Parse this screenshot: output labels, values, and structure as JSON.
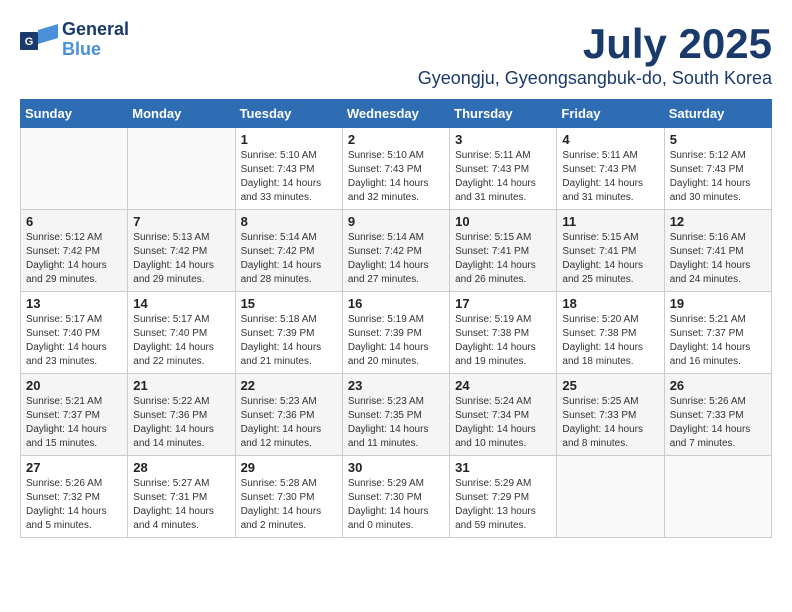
{
  "header": {
    "logo_line1": "General",
    "logo_line2": "Blue",
    "month": "July 2025",
    "location": "Gyeongju, Gyeongsangbuk-do, South Korea"
  },
  "days_of_week": [
    "Sunday",
    "Monday",
    "Tuesday",
    "Wednesday",
    "Thursday",
    "Friday",
    "Saturday"
  ],
  "weeks": [
    [
      {
        "day": "",
        "info": ""
      },
      {
        "day": "",
        "info": ""
      },
      {
        "day": "1",
        "info": "Sunrise: 5:10 AM\nSunset: 7:43 PM\nDaylight: 14 hours and 33 minutes."
      },
      {
        "day": "2",
        "info": "Sunrise: 5:10 AM\nSunset: 7:43 PM\nDaylight: 14 hours and 32 minutes."
      },
      {
        "day": "3",
        "info": "Sunrise: 5:11 AM\nSunset: 7:43 PM\nDaylight: 14 hours and 31 minutes."
      },
      {
        "day": "4",
        "info": "Sunrise: 5:11 AM\nSunset: 7:43 PM\nDaylight: 14 hours and 31 minutes."
      },
      {
        "day": "5",
        "info": "Sunrise: 5:12 AM\nSunset: 7:43 PM\nDaylight: 14 hours and 30 minutes."
      }
    ],
    [
      {
        "day": "6",
        "info": "Sunrise: 5:12 AM\nSunset: 7:42 PM\nDaylight: 14 hours and 29 minutes."
      },
      {
        "day": "7",
        "info": "Sunrise: 5:13 AM\nSunset: 7:42 PM\nDaylight: 14 hours and 29 minutes."
      },
      {
        "day": "8",
        "info": "Sunrise: 5:14 AM\nSunset: 7:42 PM\nDaylight: 14 hours and 28 minutes."
      },
      {
        "day": "9",
        "info": "Sunrise: 5:14 AM\nSunset: 7:42 PM\nDaylight: 14 hours and 27 minutes."
      },
      {
        "day": "10",
        "info": "Sunrise: 5:15 AM\nSunset: 7:41 PM\nDaylight: 14 hours and 26 minutes."
      },
      {
        "day": "11",
        "info": "Sunrise: 5:15 AM\nSunset: 7:41 PM\nDaylight: 14 hours and 25 minutes."
      },
      {
        "day": "12",
        "info": "Sunrise: 5:16 AM\nSunset: 7:41 PM\nDaylight: 14 hours and 24 minutes."
      }
    ],
    [
      {
        "day": "13",
        "info": "Sunrise: 5:17 AM\nSunset: 7:40 PM\nDaylight: 14 hours and 23 minutes."
      },
      {
        "day": "14",
        "info": "Sunrise: 5:17 AM\nSunset: 7:40 PM\nDaylight: 14 hours and 22 minutes."
      },
      {
        "day": "15",
        "info": "Sunrise: 5:18 AM\nSunset: 7:39 PM\nDaylight: 14 hours and 21 minutes."
      },
      {
        "day": "16",
        "info": "Sunrise: 5:19 AM\nSunset: 7:39 PM\nDaylight: 14 hours and 20 minutes."
      },
      {
        "day": "17",
        "info": "Sunrise: 5:19 AM\nSunset: 7:38 PM\nDaylight: 14 hours and 19 minutes."
      },
      {
        "day": "18",
        "info": "Sunrise: 5:20 AM\nSunset: 7:38 PM\nDaylight: 14 hours and 18 minutes."
      },
      {
        "day": "19",
        "info": "Sunrise: 5:21 AM\nSunset: 7:37 PM\nDaylight: 14 hours and 16 minutes."
      }
    ],
    [
      {
        "day": "20",
        "info": "Sunrise: 5:21 AM\nSunset: 7:37 PM\nDaylight: 14 hours and 15 minutes."
      },
      {
        "day": "21",
        "info": "Sunrise: 5:22 AM\nSunset: 7:36 PM\nDaylight: 14 hours and 14 minutes."
      },
      {
        "day": "22",
        "info": "Sunrise: 5:23 AM\nSunset: 7:36 PM\nDaylight: 14 hours and 12 minutes."
      },
      {
        "day": "23",
        "info": "Sunrise: 5:23 AM\nSunset: 7:35 PM\nDaylight: 14 hours and 11 minutes."
      },
      {
        "day": "24",
        "info": "Sunrise: 5:24 AM\nSunset: 7:34 PM\nDaylight: 14 hours and 10 minutes."
      },
      {
        "day": "25",
        "info": "Sunrise: 5:25 AM\nSunset: 7:33 PM\nDaylight: 14 hours and 8 minutes."
      },
      {
        "day": "26",
        "info": "Sunrise: 5:26 AM\nSunset: 7:33 PM\nDaylight: 14 hours and 7 minutes."
      }
    ],
    [
      {
        "day": "27",
        "info": "Sunrise: 5:26 AM\nSunset: 7:32 PM\nDaylight: 14 hours and 5 minutes."
      },
      {
        "day": "28",
        "info": "Sunrise: 5:27 AM\nSunset: 7:31 PM\nDaylight: 14 hours and 4 minutes."
      },
      {
        "day": "29",
        "info": "Sunrise: 5:28 AM\nSunset: 7:30 PM\nDaylight: 14 hours and 2 minutes."
      },
      {
        "day": "30",
        "info": "Sunrise: 5:29 AM\nSunset: 7:30 PM\nDaylight: 14 hours and 0 minutes."
      },
      {
        "day": "31",
        "info": "Sunrise: 5:29 AM\nSunset: 7:29 PM\nDaylight: 13 hours and 59 minutes."
      },
      {
        "day": "",
        "info": ""
      },
      {
        "day": "",
        "info": ""
      }
    ]
  ]
}
